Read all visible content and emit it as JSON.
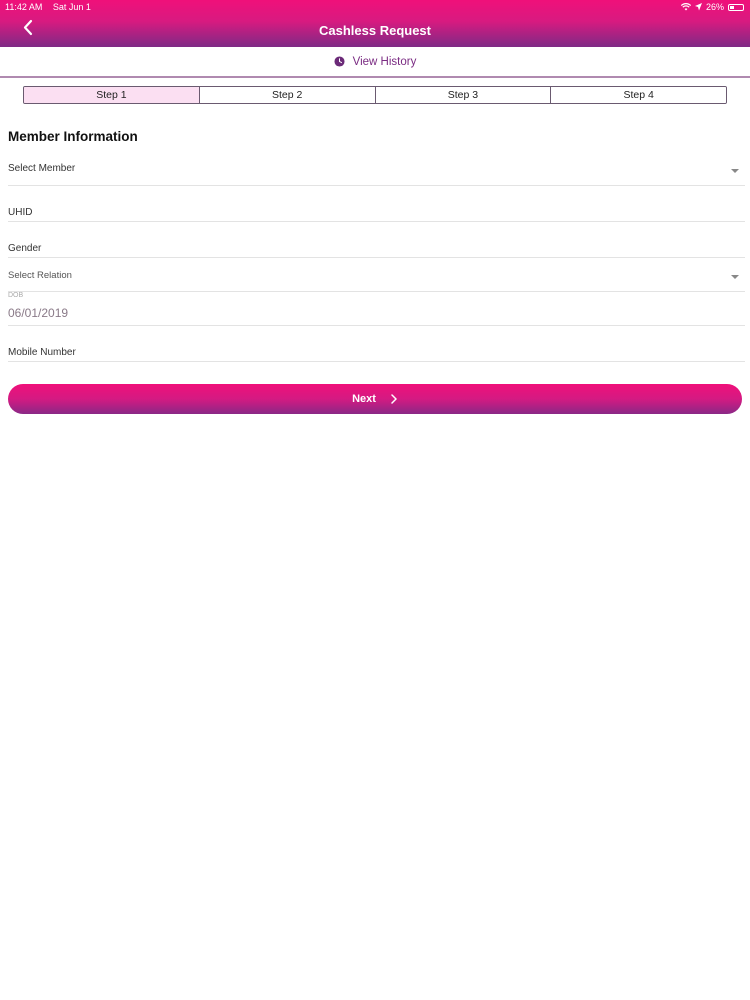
{
  "status_bar": {
    "time": "11:42 AM",
    "date": "Sat Jun 1",
    "battery": "26%"
  },
  "header": {
    "title": "Cashless Request",
    "back_icon": "chevron-left-icon"
  },
  "history": {
    "label": "View History",
    "icon": "clock-icon"
  },
  "steps": [
    {
      "label": "Step 1",
      "active": true
    },
    {
      "label": "Step 2",
      "active": false
    },
    {
      "label": "Step 3",
      "active": false
    },
    {
      "label": "Step 4",
      "active": false
    }
  ],
  "section_title": "Member Information",
  "form": {
    "select_member": {
      "placeholder": "Select Member"
    },
    "uhid": {
      "label": "UHID"
    },
    "gender": {
      "label": "Gender"
    },
    "select_relation": {
      "placeholder": "Select Relation"
    },
    "dob": {
      "caption": "DOB",
      "value": "06/01/2019"
    },
    "mobile": {
      "label": "Mobile Number"
    }
  },
  "next_button": {
    "label": "Next",
    "icon": "chevron-right-icon"
  },
  "colors": {
    "brand_pink": "#f0107a",
    "brand_purple": "#7e2a85",
    "active_step_bg": "#fbdff2"
  }
}
